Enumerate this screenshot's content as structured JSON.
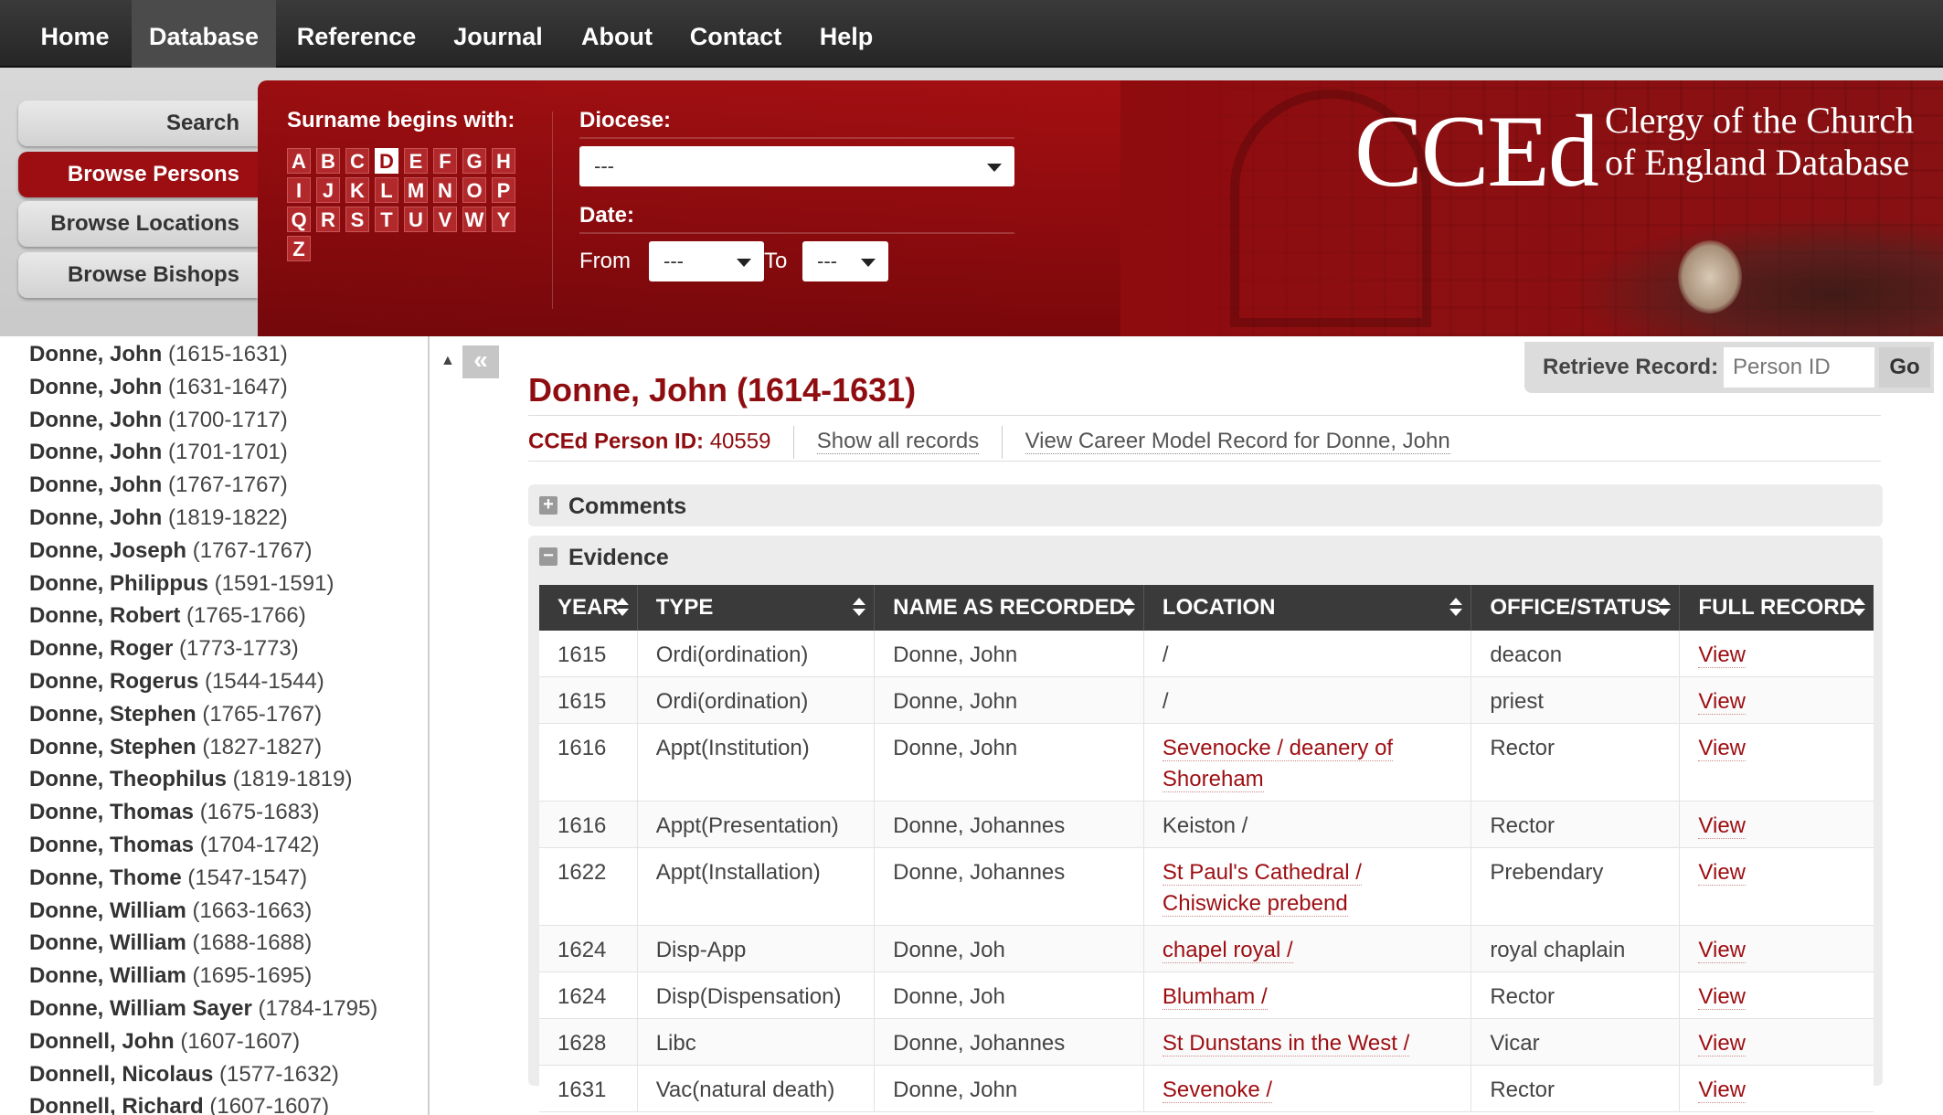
{
  "topnav": {
    "items": [
      {
        "label": "Home"
      },
      {
        "label": "Database",
        "active": true
      },
      {
        "label": "Reference"
      },
      {
        "label": "Journal"
      },
      {
        "label": "About"
      },
      {
        "label": "Contact"
      },
      {
        "label": "Help"
      }
    ]
  },
  "side_tabs": [
    {
      "label": "Search"
    },
    {
      "label": "Browse Persons",
      "active": true
    },
    {
      "label": "Browse Locations"
    },
    {
      "label": "Browse Bishops"
    }
  ],
  "filters": {
    "surname_label": "Surname begins with:",
    "letters": [
      "A",
      "B",
      "C",
      "D",
      "E",
      "F",
      "G",
      "H",
      "I",
      "J",
      "K",
      "L",
      "M",
      "N",
      "O",
      "P",
      "Q",
      "R",
      "S",
      "T",
      "U",
      "V",
      "W",
      "Y",
      "Z"
    ],
    "active_letter": "D",
    "diocese_label": "Diocese:",
    "diocese_value": "---",
    "date_label": "Date:",
    "from_label": "From",
    "from_value": "---",
    "to_label": "To",
    "to_value": "---"
  },
  "logo": {
    "main": "CCEd",
    "line1": "Clergy of the Church",
    "line2": "of England Database"
  },
  "person_list": [
    {
      "name": "Donne, John",
      "dates": "(1615-1631)"
    },
    {
      "name": "Donne, John",
      "dates": "(1631-1647)"
    },
    {
      "name": "Donne, John",
      "dates": "(1700-1717)"
    },
    {
      "name": "Donne, John",
      "dates": "(1701-1701)"
    },
    {
      "name": "Donne, John",
      "dates": "(1767-1767)"
    },
    {
      "name": "Donne, John",
      "dates": "(1819-1822)"
    },
    {
      "name": "Donne, Joseph",
      "dates": "(1767-1767)"
    },
    {
      "name": "Donne, Philippus",
      "dates": "(1591-1591)"
    },
    {
      "name": "Donne, Robert",
      "dates": "(1765-1766)"
    },
    {
      "name": "Donne, Roger",
      "dates": "(1773-1773)"
    },
    {
      "name": "Donne, Rogerus",
      "dates": "(1544-1544)"
    },
    {
      "name": "Donne, Stephen",
      "dates": "(1765-1767)"
    },
    {
      "name": "Donne, Stephen",
      "dates": "(1827-1827)"
    },
    {
      "name": "Donne, Theophilus",
      "dates": "(1819-1819)"
    },
    {
      "name": "Donne, Thomas",
      "dates": "(1675-1683)"
    },
    {
      "name": "Donne, Thomas",
      "dates": "(1704-1742)"
    },
    {
      "name": "Donne, Thome",
      "dates": "(1547-1547)"
    },
    {
      "name": "Donne, William",
      "dates": "(1663-1663)"
    },
    {
      "name": "Donne, William",
      "dates": "(1688-1688)"
    },
    {
      "name": "Donne, William",
      "dates": "(1695-1695)"
    },
    {
      "name": "Donne, William Sayer",
      "dates": "(1784-1795)"
    },
    {
      "name": "Donnell, John",
      "dates": "(1607-1607)"
    },
    {
      "name": "Donnell, Nicolaus",
      "dates": "(1577-1632)"
    },
    {
      "name": "Donnell, Richard",
      "dates": "(1607-1607)"
    }
  ],
  "collapse_button": "«",
  "scroll_up": "▲",
  "retrieve": {
    "label": "Retrieve Record:",
    "placeholder": "Person ID",
    "go": "Go"
  },
  "record": {
    "title": "Donne, John (1614-1631)",
    "id_label": "CCEd Person ID:",
    "id_value": "40559",
    "show_all": "Show all records",
    "career_link": "View Career Model Record for Donne, John"
  },
  "sections": {
    "comments": {
      "toggle": "+",
      "title": "Comments"
    },
    "evidence": {
      "toggle": "−",
      "title": "Evidence"
    }
  },
  "evidence_table": {
    "columns": [
      "YEAR",
      "TYPE",
      "NAME AS RECORDED",
      "LOCATION",
      "OFFICE/STATUS",
      "FULL RECORD"
    ],
    "rows": [
      {
        "year": "1615",
        "type": "Ordi(ordination)",
        "name": "Donne, John",
        "location": "/",
        "location_link": false,
        "office": "deacon",
        "view": "View"
      },
      {
        "year": "1615",
        "type": "Ordi(ordination)",
        "name": "Donne, John",
        "location": "/",
        "location_link": false,
        "office": "priest",
        "view": "View"
      },
      {
        "year": "1616",
        "type": "Appt(Institution)",
        "name": "Donne, John",
        "location": "Sevenocke / deanery of Shoreham",
        "location_link": true,
        "office": "Rector",
        "view": "View"
      },
      {
        "year": "1616",
        "type": "Appt(Presentation)",
        "name": "Donne, Johannes",
        "location": "Keiston /",
        "location_link": false,
        "office": "Rector",
        "view": "View"
      },
      {
        "year": "1622",
        "type": "Appt(Installation)",
        "name": "Donne, Johannes",
        "location": "St Paul's Cathedral / Chiswicke prebend",
        "location_link": true,
        "office": "Prebendary",
        "view": "View"
      },
      {
        "year": "1624",
        "type": "Disp-App",
        "name": "Donne, Joh",
        "location": "chapel royal /",
        "location_link": true,
        "office": "royal chaplain",
        "view": "View"
      },
      {
        "year": "1624",
        "type": "Disp(Dispensation)",
        "name": "Donne, Joh",
        "location": "Blumham /",
        "location_link": true,
        "office": "Rector",
        "view": "View"
      },
      {
        "year": "1628",
        "type": "Libc",
        "name": "Donne, Johannes",
        "location": "St Dunstans in the West /",
        "location_link": true,
        "office": "Vicar",
        "view": "View"
      },
      {
        "year": "1631",
        "type": "Vac(natural death)",
        "name": "Donne, John",
        "location": "Sevenoke /",
        "location_link": true,
        "office": "Rector",
        "view": "View"
      }
    ]
  },
  "colors": {
    "brand_red": "#9d0e12",
    "nav_dark": "#2f2f2f",
    "table_header": "#3a3a3a"
  }
}
